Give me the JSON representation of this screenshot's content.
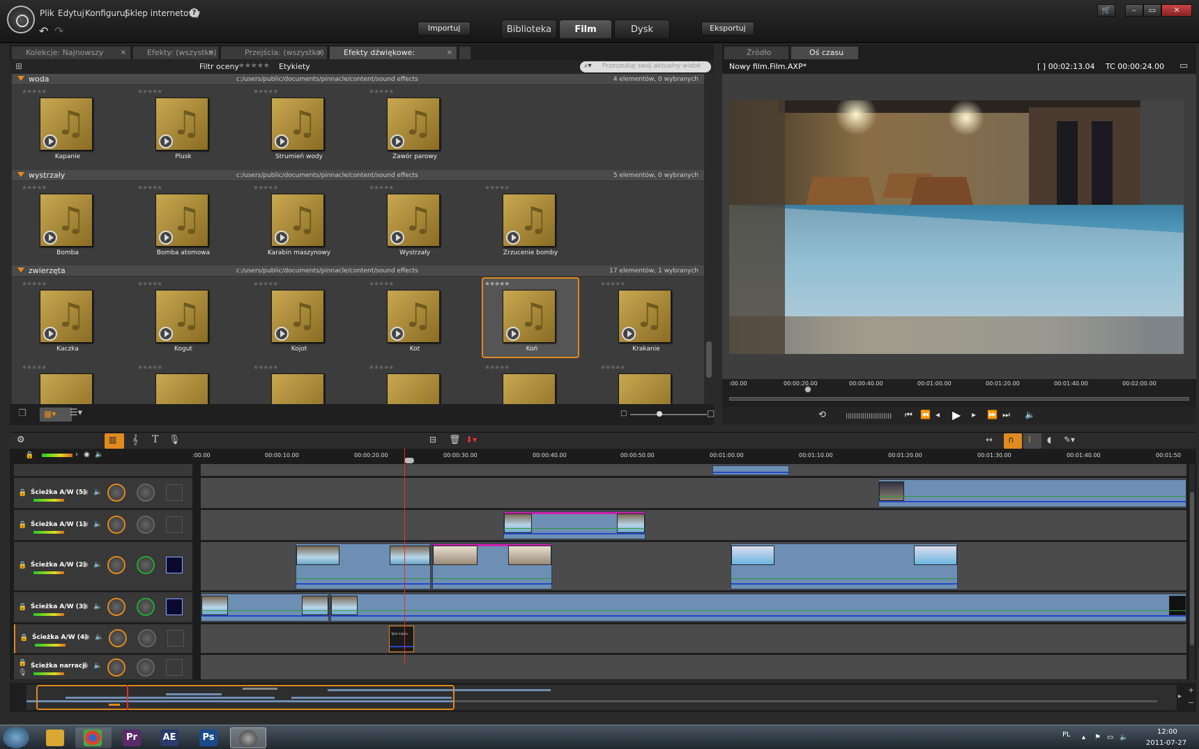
{
  "menu": {
    "items": [
      "Plik",
      "Edytuj",
      "Konfiguruj",
      "Sklep internetowy"
    ],
    "help": "?"
  },
  "header": {
    "import_label": "Importuj",
    "export_label": "Eksportuj",
    "tabs": [
      "Biblioteka",
      "Film",
      "Dysk"
    ],
    "active_tab": "Film",
    "window_controls": [
      "–",
      "▭",
      "✕"
    ]
  },
  "library": {
    "tabs": [
      {
        "label": "Kolekcje: Najnowszy import",
        "close": "×"
      },
      {
        "label": "Efekty: (wszystko)",
        "close": "×"
      },
      {
        "label": "Przejścia: (wszystko)",
        "close": "×"
      },
      {
        "label": "Efekty dźwiękowe: (wszystko)",
        "close": "×",
        "active": true
      }
    ],
    "filter_label": "Filtr oceny",
    "tags_label": "Etykiety",
    "search_placeholder": "Przeszukaj swój aktualny widok",
    "rating": "★★★★★",
    "groups": [
      {
        "name": "woda",
        "path": "c:/users/public/documents/pinnacle/content/sound effects",
        "count": "4 elementów, 0 wybranych",
        "items": [
          "Kapanie",
          "Plusk",
          "Strumień wody",
          "Zawór parowy"
        ]
      },
      {
        "name": "wystrzały",
        "path": "c:/users/public/documents/pinnacle/content/sound effects",
        "count": "5 elementów, 0 wybranych",
        "items": [
          "Bomba",
          "Bomba atomowa",
          "Karabin maszynowy",
          "Wystrzały",
          "Zrzucenie bomby"
        ]
      },
      {
        "name": "zwierzęta",
        "path": "c:/users/public/documents/pinnacle/content/sound effects",
        "count": "17 elementów, 1 wybranych",
        "items": [
          "Kaczka",
          "Kogut",
          "Kojot",
          "Kot",
          "Koń",
          "Krakanie"
        ],
        "selected": "Koń"
      }
    ]
  },
  "player": {
    "tabs": [
      "Źródło",
      "Oś czasu"
    ],
    "active_tab": "Oś czasu",
    "title": "Nowy film.Film.AXP*",
    "duration": "[ ] 00:02:13.04",
    "tc": "TC 00:00:24.00",
    "ruler": [
      ":00.00",
      "00:00:20.00",
      "00:00:40.00",
      "00:01:00.00",
      "00:01:20.00",
      "00:01:40.00",
      "00:02:00.00"
    ]
  },
  "timeline": {
    "ruler": [
      ":00.00",
      "00:00:10.00",
      "00:00:20.00",
      "00:00:30.00",
      "00:00:40.00",
      "00:00:50.00",
      "00:01:00.00",
      "00:01:10.00",
      "00:01:20.00",
      "00:01:30.00",
      "00:01:40.00",
      "00:01:50"
    ],
    "tracks": [
      "Ścieżka A/W (5)",
      "Ścieżka A/W (1)",
      "Ścieżka A/W (2)",
      "Ścieżka A/W (3)",
      "Ścieżka A/W (4)",
      "Ścieżka narracji"
    ],
    "title_clip_text": "Tytuł napisu"
  },
  "taskbar": {
    "apps": [
      {
        "name": "explorer",
        "label": "",
        "color": "#d8a830"
      },
      {
        "name": "chrome",
        "label": "",
        "color": "#e04030"
      },
      {
        "name": "premiere",
        "label": "Pr",
        "color": "#5a2a6a"
      },
      {
        "name": "after-effects",
        "label": "AE",
        "color": "#2a3a6a"
      },
      {
        "name": "photoshop",
        "label": "Ps",
        "color": "#1a4a8a"
      },
      {
        "name": "studio",
        "label": "",
        "color": "#777"
      }
    ],
    "lang": "PL",
    "time": "12:00",
    "date": "2011-07-27"
  },
  "colors": {
    "accent": "#e08a20",
    "clip": "#6d8fb3",
    "playhead": "#e03030"
  }
}
